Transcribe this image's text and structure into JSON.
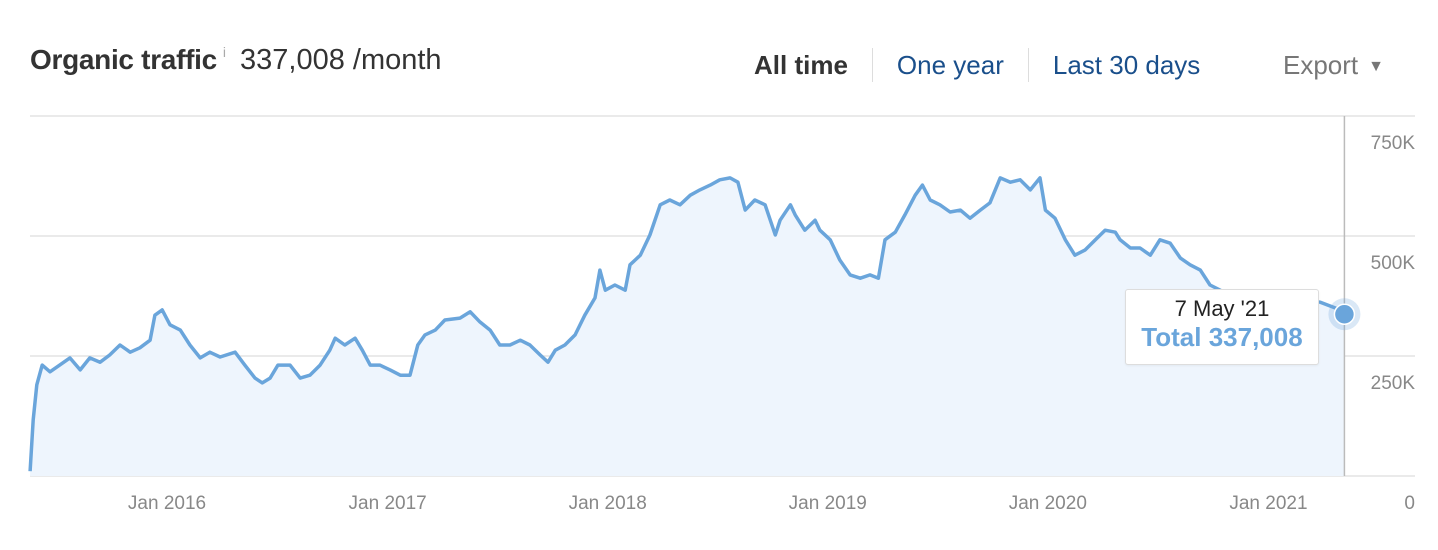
{
  "header": {
    "title": "Organic traffic",
    "info_icon": "i",
    "metric": "337,008 /month"
  },
  "ranges": [
    {
      "label": "All time",
      "active": true
    },
    {
      "label": "One year",
      "active": false
    },
    {
      "label": "Last 30 days",
      "active": false
    }
  ],
  "export": {
    "label": "Export",
    "icon": "caret-down"
  },
  "tooltip": {
    "date": "7 May '21",
    "label": "Total 337,008"
  },
  "colors": {
    "line": "#6aa5db",
    "fill": "#eef5fd",
    "grid": "#e3e3e3",
    "link": "#1a4f8b"
  },
  "chart_data": {
    "type": "area",
    "title": "",
    "xlabel": "",
    "ylabel": "",
    "y_axis_position": "right",
    "ylim": [
      0,
      750000
    ],
    "y_ticks": [
      {
        "value": 750000,
        "label": "750K"
      },
      {
        "value": 500000,
        "label": "500K"
      },
      {
        "value": 250000,
        "label": "250K"
      },
      {
        "value": 0,
        "label": "0"
      }
    ],
    "x_ticks": [
      {
        "date": "2016-01-01",
        "label": "Jan 2016"
      },
      {
        "date": "2017-01-01",
        "label": "Jan 2017"
      },
      {
        "date": "2018-01-01",
        "label": "Jan 2018"
      },
      {
        "date": "2019-01-01",
        "label": "Jan 2019"
      },
      {
        "date": "2020-01-01",
        "label": "Jan 2020"
      },
      {
        "date": "2021-01-01",
        "label": "Jan 2021"
      }
    ],
    "grid": true,
    "highlight": {
      "date": "2021-05-07",
      "value": 337008
    },
    "series": [
      {
        "points": [
          [
            "2015-05-19",
            10000
          ],
          [
            "2015-05-24",
            117000
          ],
          [
            "2015-05-30",
            190000
          ],
          [
            "2015-06-08",
            231000
          ],
          [
            "2015-06-21",
            217000
          ],
          [
            "2015-07-07",
            231000
          ],
          [
            "2015-07-24",
            246000
          ],
          [
            "2015-08-10",
            221000
          ],
          [
            "2015-08-26",
            246000
          ],
          [
            "2015-09-12",
            237000
          ],
          [
            "2015-09-28",
            252000
          ],
          [
            "2015-10-15",
            273000
          ],
          [
            "2015-11-01",
            258000
          ],
          [
            "2015-11-17",
            267000
          ],
          [
            "2015-12-04",
            283000
          ],
          [
            "2015-12-12",
            335000
          ],
          [
            "2015-12-24",
            346000
          ],
          [
            "2016-01-06",
            315000
          ],
          [
            "2016-01-23",
            304000
          ],
          [
            "2016-02-08",
            273000
          ],
          [
            "2016-02-25",
            246000
          ],
          [
            "2016-03-12",
            258000
          ],
          [
            "2016-03-29",
            248000
          ],
          [
            "2016-04-23",
            258000
          ],
          [
            "2016-05-09",
            231000
          ],
          [
            "2016-05-26",
            204000
          ],
          [
            "2016-06-07",
            194000
          ],
          [
            "2016-06-20",
            204000
          ],
          [
            "2016-07-03",
            231000
          ],
          [
            "2016-07-23",
            231000
          ],
          [
            "2016-08-09",
            204000
          ],
          [
            "2016-08-25",
            210000
          ],
          [
            "2016-09-11",
            231000
          ],
          [
            "2016-09-27",
            262000
          ],
          [
            "2016-10-06",
            287000
          ],
          [
            "2016-10-22",
            273000
          ],
          [
            "2016-11-08",
            287000
          ],
          [
            "2016-11-20",
            262000
          ],
          [
            "2016-12-03",
            231000
          ],
          [
            "2016-12-19",
            231000
          ],
          [
            "2017-01-05",
            221000
          ],
          [
            "2017-01-22",
            210000
          ],
          [
            "2017-02-07",
            210000
          ],
          [
            "2017-02-20",
            273000
          ],
          [
            "2017-03-04",
            294000
          ],
          [
            "2017-03-21",
            304000
          ],
          [
            "2017-04-06",
            325000
          ],
          [
            "2017-05-01",
            329000
          ],
          [
            "2017-05-18",
            342000
          ],
          [
            "2017-06-03",
            321000
          ],
          [
            "2017-06-20",
            304000
          ],
          [
            "2017-07-06",
            273000
          ],
          [
            "2017-07-23",
            273000
          ],
          [
            "2017-08-09",
            283000
          ],
          [
            "2017-08-25",
            273000
          ],
          [
            "2017-09-11",
            252000
          ],
          [
            "2017-09-24",
            237000
          ],
          [
            "2017-10-06",
            262000
          ],
          [
            "2017-10-22",
            273000
          ],
          [
            "2017-11-08",
            294000
          ],
          [
            "2017-11-24",
            335000
          ],
          [
            "2017-12-11",
            371000
          ],
          [
            "2017-12-19",
            429000
          ],
          [
            "2017-12-28",
            387000
          ],
          [
            "2018-01-13",
            398000
          ],
          [
            "2018-01-30",
            387000
          ],
          [
            "2018-02-07",
            440000
          ],
          [
            "2018-02-24",
            460000
          ],
          [
            "2018-03-12",
            502000
          ],
          [
            "2018-03-29",
            565000
          ],
          [
            "2018-04-14",
            575000
          ],
          [
            "2018-05-01",
            565000
          ],
          [
            "2018-05-18",
            585000
          ],
          [
            "2018-06-03",
            596000
          ],
          [
            "2018-06-20",
            606000
          ],
          [
            "2018-07-06",
            617000
          ],
          [
            "2018-07-23",
            621000
          ],
          [
            "2018-08-05",
            612000
          ],
          [
            "2018-08-17",
            554000
          ],
          [
            "2018-09-02",
            575000
          ],
          [
            "2018-09-19",
            565000
          ],
          [
            "2018-10-06",
            502000
          ],
          [
            "2018-10-14",
            533000
          ],
          [
            "2018-10-31",
            565000
          ],
          [
            "2018-11-08",
            544000
          ],
          [
            "2018-11-24",
            512000
          ],
          [
            "2018-12-11",
            533000
          ],
          [
            "2018-12-19",
            512000
          ],
          [
            "2019-01-05",
            492000
          ],
          [
            "2019-01-21",
            450000
          ],
          [
            "2019-02-07",
            419000
          ],
          [
            "2019-02-24",
            412000
          ],
          [
            "2019-03-12",
            419000
          ],
          [
            "2019-03-26",
            412000
          ],
          [
            "2019-04-06",
            492000
          ],
          [
            "2019-04-23",
            508000
          ],
          [
            "2019-05-09",
            544000
          ],
          [
            "2019-05-26",
            585000
          ],
          [
            "2019-06-07",
            606000
          ],
          [
            "2019-06-20",
            575000
          ],
          [
            "2019-07-06",
            565000
          ],
          [
            "2019-07-23",
            550000
          ],
          [
            "2019-08-09",
            554000
          ],
          [
            "2019-08-25",
            537000
          ],
          [
            "2019-09-11",
            554000
          ],
          [
            "2019-09-27",
            569000
          ],
          [
            "2019-10-14",
            621000
          ],
          [
            "2019-10-31",
            612000
          ],
          [
            "2019-11-16",
            617000
          ],
          [
            "2019-12-03",
            596000
          ],
          [
            "2019-12-19",
            621000
          ],
          [
            "2019-12-28",
            554000
          ],
          [
            "2020-01-13",
            537000
          ],
          [
            "2020-01-30",
            492000
          ],
          [
            "2020-02-15",
            460000
          ],
          [
            "2020-03-03",
            471000
          ],
          [
            "2020-03-20",
            492000
          ],
          [
            "2020-04-05",
            512000
          ],
          [
            "2020-04-22",
            508000
          ],
          [
            "2020-04-30",
            492000
          ],
          [
            "2020-05-17",
            475000
          ],
          [
            "2020-06-02",
            475000
          ],
          [
            "2020-06-19",
            460000
          ],
          [
            "2020-07-05",
            492000
          ],
          [
            "2020-07-22",
            485000
          ],
          [
            "2020-08-08",
            454000
          ],
          [
            "2020-08-24",
            440000
          ],
          [
            "2020-09-10",
            429000
          ],
          [
            "2020-09-26",
            398000
          ],
          [
            "2020-10-13",
            387000
          ],
          [
            "2020-10-30",
            377000
          ],
          [
            "2020-11-15",
            367000
          ],
          [
            "2020-12-18",
            362000
          ],
          [
            "2021-01-20",
            375000
          ],
          [
            "2021-02-23",
            367000
          ],
          [
            "2021-03-28",
            362000
          ],
          [
            "2021-04-22",
            350000
          ],
          [
            "2021-05-07",
            337008
          ]
        ]
      }
    ]
  }
}
